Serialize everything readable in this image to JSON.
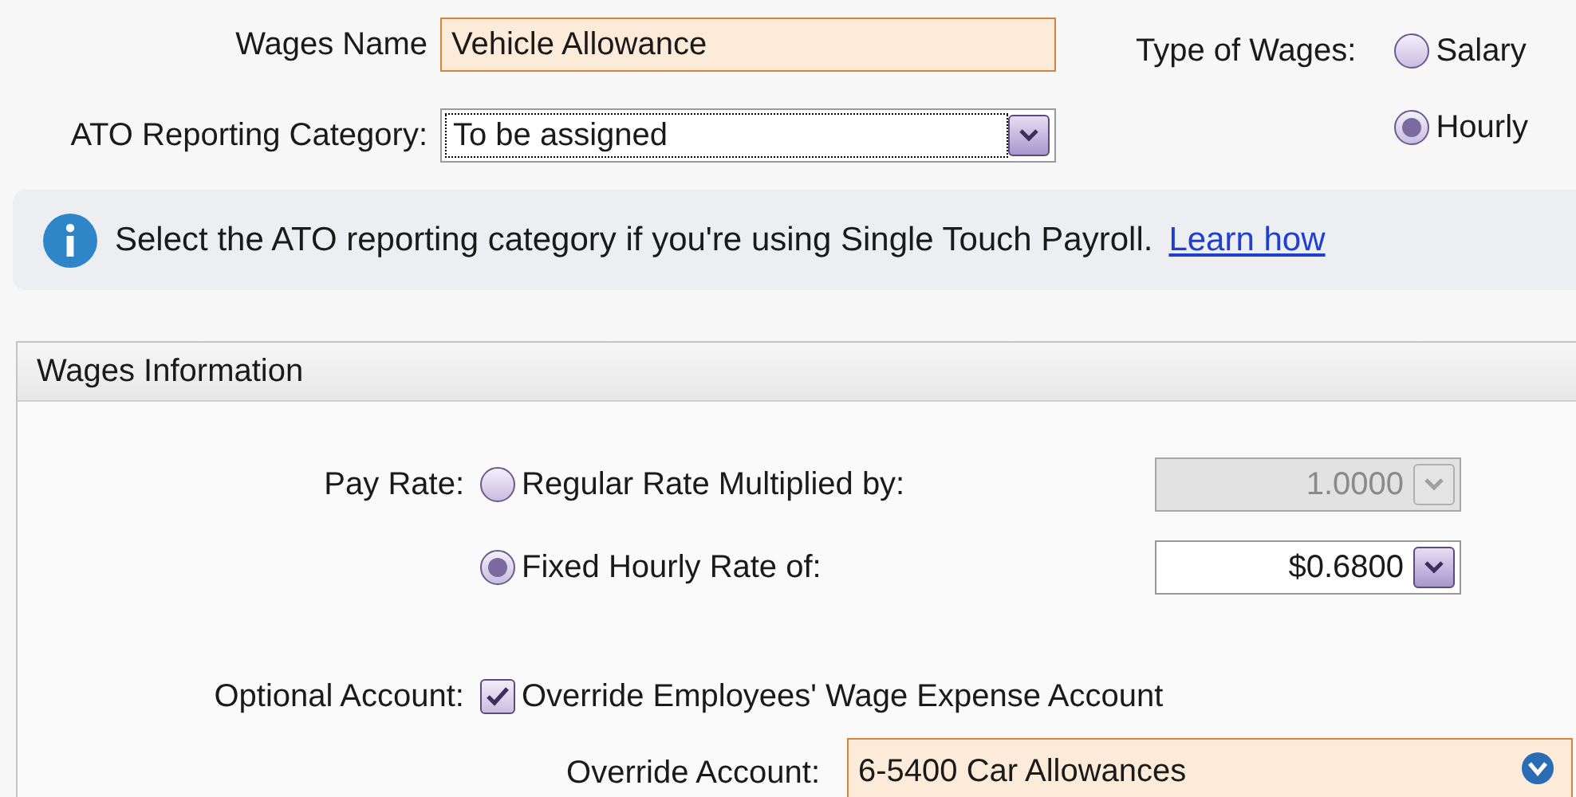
{
  "wages_name": {
    "label": "Wages Name",
    "value": "Vehicle Allowance"
  },
  "ato_category": {
    "label": "ATO Reporting Category:",
    "value": "To be assigned"
  },
  "type_of_wages": {
    "label": "Type of Wages:",
    "options": [
      {
        "label": "Salary",
        "selected": false
      },
      {
        "label": "Hourly",
        "selected": true
      }
    ]
  },
  "info": {
    "text": "Select the ATO reporting category if you're using Single Touch Payroll.",
    "link": "Learn how"
  },
  "wages_information": {
    "title": "Wages Information",
    "pay_rate": {
      "label": "Pay Rate:",
      "options": [
        {
          "label": "Regular Rate Multiplied by:",
          "selected": false,
          "value": "1.0000",
          "disabled": true
        },
        {
          "label": "Fixed Hourly Rate of:",
          "selected": true,
          "value": "$0.6800",
          "disabled": false
        }
      ]
    },
    "optional_account": {
      "label": "Optional Account:",
      "checkbox": {
        "label": "Override Employees' Wage Expense Account",
        "checked": true
      },
      "override_label": "Override Account:",
      "override_value": "6-5400 Car Allowances"
    }
  }
}
